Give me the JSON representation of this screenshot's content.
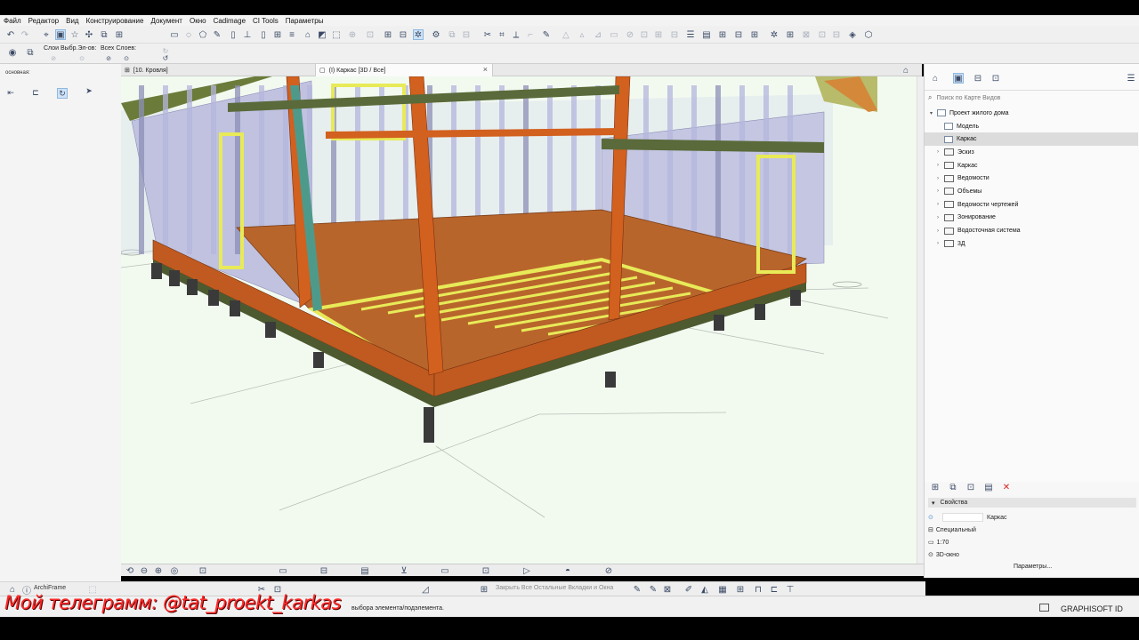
{
  "menu": {
    "items": [
      "Файл",
      "Редактор",
      "Вид",
      "Конструирование",
      "Документ",
      "Окно",
      "Cadimage",
      "CI Tools",
      "Параметры"
    ]
  },
  "toolbar": {
    "layers_label": "Слои Выбр.Эл-ов:",
    "all_layers_label": "Всех Слоев:",
    "left_panel_label": "основная:"
  },
  "tabs": {
    "roof": "[10. Кровля]",
    "frame": "(I) Каркас [3D / Все]"
  },
  "navigator": {
    "search_placeholder": "Поиск по Карте Видов",
    "project": "Проект жилого дома",
    "items": [
      {
        "label": "Модель",
        "type": "view"
      },
      {
        "label": "Каркас",
        "type": "view",
        "selected": true
      },
      {
        "label": "Эскиз",
        "type": "folder"
      },
      {
        "label": "Каркас",
        "type": "folder"
      },
      {
        "label": "Ведомости",
        "type": "folder"
      },
      {
        "label": "Объемы",
        "type": "folder"
      },
      {
        "label": "Ведомости чертежей",
        "type": "folder"
      },
      {
        "label": "Зонирование",
        "type": "folder"
      },
      {
        "label": "Водосточная система",
        "type": "folder"
      },
      {
        "label": "3Д",
        "type": "folder"
      }
    ]
  },
  "properties": {
    "header": "Свойства",
    "name": "Каркас",
    "special": "Специальный",
    "scale": "1:70",
    "window": "3D-окно",
    "params_button": "Параметры..."
  },
  "bottom": {
    "archiframe": "ArchiFrame",
    "hint": "Закрыть Все Остальные Вкладки и Окна",
    "status": "выбора элемента/подэлемента.",
    "graphisoft": "GRAPHISOFT ID"
  },
  "watermark": "Мой телеграмм: @tat_proekt_karkas",
  "colors": {
    "ground": "#f2faf0",
    "stud": "#b4b6dc",
    "stud_dark": "#8c8fb5",
    "yellow_frame": "#e8ea58",
    "orange_post": "#d2601e",
    "floor_wood": "#b8652c",
    "dark_green": "#5a6a3a",
    "teal_brace": "#4e9a8a",
    "pier": "#3a3a3a",
    "watermark": "#ff2a2a"
  }
}
